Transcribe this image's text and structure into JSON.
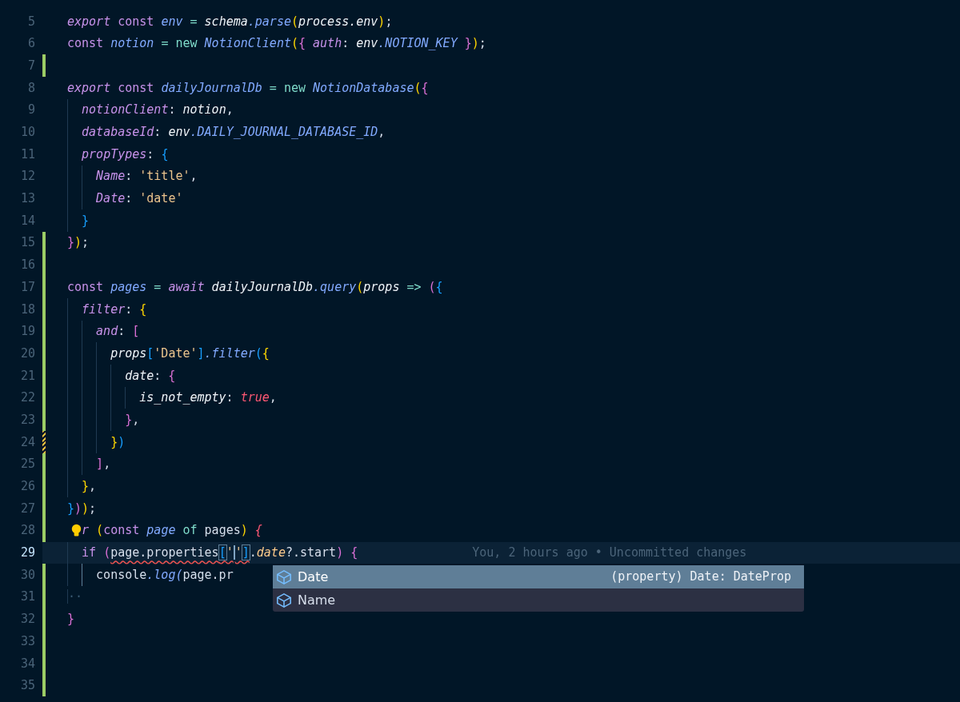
{
  "editor": {
    "lines": [
      {
        "number": "5",
        "added": false,
        "modified": false,
        "current": false,
        "tokens": [
          {
            "text": "export",
            "kind": "kwi"
          },
          {
            "text": " const",
            "kind": "kw"
          },
          {
            "text": " env",
            "kind": "var"
          },
          {
            "text": " =",
            "kind": "op"
          },
          {
            "text": " schema",
            "kind": "plaini"
          },
          {
            "text": ".parse",
            "kind": "fn"
          },
          {
            "text": "(",
            "kind": "b1"
          },
          {
            "text": "process.env",
            "kind": "plaini"
          },
          {
            "text": ")",
            "kind": "b1"
          },
          {
            "text": ";"
          }
        ]
      },
      {
        "number": "6",
        "added": false,
        "modified": false,
        "current": false,
        "tokens": [
          {
            "text": "const",
            "kind": "kw"
          },
          {
            "text": " notion",
            "kind": "var"
          },
          {
            "text": " =",
            "kind": "op"
          },
          {
            "text": " new",
            "kind": "op"
          },
          {
            "text": " NotionClient",
            "kind": "fn"
          },
          {
            "text": "(",
            "kind": "b1"
          },
          {
            "text": "{",
            "kind": "b2"
          },
          {
            "text": " auth",
            "kind": "prop"
          },
          {
            "text": ":"
          },
          {
            "text": " env",
            "kind": "plaini"
          },
          {
            "text": ".NOTION_KEY",
            "kind": "fn"
          },
          {
            "text": " }",
            "kind": "b2"
          },
          {
            "text": ")",
            "kind": "b1"
          },
          {
            "text": ";"
          }
        ]
      },
      {
        "number": "7",
        "added": true,
        "modified": false,
        "current": false
      },
      {
        "number": "8",
        "added": false,
        "modified": false,
        "current": false,
        "tokens": [
          {
            "text": "export",
            "kind": "kwi"
          },
          {
            "text": " const",
            "kind": "kw"
          },
          {
            "text": " dailyJournalDb",
            "kind": "var"
          },
          {
            "text": " =",
            "kind": "op"
          },
          {
            "text": " new",
            "kind": "op"
          },
          {
            "text": " NotionDatabase",
            "kind": "fn"
          },
          {
            "text": "(",
            "kind": "b1"
          },
          {
            "text": "{",
            "kind": "b2"
          }
        ]
      },
      {
        "number": "9",
        "added": false,
        "modified": false,
        "current": false,
        "guides": [
          {
            "active": false
          }
        ],
        "tokens": [
          {
            "text": "notionClient",
            "kind": "prop"
          },
          {
            "text": ":"
          },
          {
            "text": " notion",
            "kind": "plaini"
          },
          {
            "text": ","
          }
        ]
      },
      {
        "number": "10",
        "added": false,
        "modified": false,
        "current": false,
        "guides": [
          {
            "active": false
          }
        ],
        "tokens": [
          {
            "text": "databaseId",
            "kind": "prop"
          },
          {
            "text": ":"
          },
          {
            "text": " env",
            "kind": "plaini"
          },
          {
            "text": ".DAILY_JOURNAL_DATABASE_ID",
            "kind": "fn"
          },
          {
            "text": ","
          }
        ]
      },
      {
        "number": "11",
        "added": false,
        "modified": false,
        "current": false,
        "guides": [
          {
            "active": false
          }
        ],
        "tokens": [
          {
            "text": "propTypes",
            "kind": "prop"
          },
          {
            "text": ":"
          },
          {
            "text": " {",
            "kind": "b3"
          }
        ]
      },
      {
        "number": "12",
        "added": false,
        "modified": false,
        "current": false,
        "guides": [
          {
            "active": false
          },
          {
            "active": false
          }
        ],
        "tokens": [
          {
            "text": "Name",
            "kind": "prop"
          },
          {
            "text": ":"
          },
          {
            "text": " 'title'",
            "kind": "str"
          },
          {
            "text": ","
          }
        ]
      },
      {
        "number": "13",
        "added": false,
        "modified": false,
        "current": false,
        "guides": [
          {
            "active": false
          },
          {
            "active": false
          }
        ],
        "tokens": [
          {
            "text": "Date",
            "kind": "prop"
          },
          {
            "text": ":"
          },
          {
            "text": " 'date'",
            "kind": "str"
          }
        ]
      },
      {
        "number": "14",
        "added": false,
        "modified": false,
        "current": false,
        "guides": [
          {
            "active": false
          }
        ],
        "tokens": [
          {
            "text": "}",
            "kind": "b3"
          }
        ]
      },
      {
        "number": "15",
        "added": true,
        "modified": false,
        "current": false,
        "tokens": [
          {
            "text": "}",
            "kind": "b2"
          },
          {
            "text": ")",
            "kind": "b1"
          },
          {
            "text": ";"
          }
        ]
      },
      {
        "number": "16",
        "added": true,
        "modified": false,
        "current": false
      },
      {
        "number": "17",
        "added": true,
        "modified": false,
        "current": false,
        "tokens": [
          {
            "text": "const",
            "kind": "kw"
          },
          {
            "text": " pages",
            "kind": "var"
          },
          {
            "text": " =",
            "kind": "op"
          },
          {
            "text": " await",
            "kind": "kwi"
          },
          {
            "text": " dailyJournalDb",
            "kind": "plaini"
          },
          {
            "text": ".query",
            "kind": "fn"
          },
          {
            "text": "(",
            "kind": "b1"
          },
          {
            "text": "props",
            "kind": "plaini"
          },
          {
            "text": " =>",
            "kind": "op"
          },
          {
            "text": " (",
            "kind": "b2"
          },
          {
            "text": "{",
            "kind": "b3"
          }
        ]
      },
      {
        "number": "18",
        "added": true,
        "modified": false,
        "current": false,
        "guides": [
          {
            "active": false
          }
        ],
        "tokens": [
          {
            "text": "filter",
            "kind": "prop"
          },
          {
            "text": ":"
          },
          {
            "text": " {",
            "kind": "b1"
          }
        ]
      },
      {
        "number": "19",
        "added": true,
        "modified": false,
        "current": false,
        "guides": [
          {
            "active": false
          },
          {
            "active": false
          }
        ],
        "tokens": [
          {
            "text": "and",
            "kind": "prop"
          },
          {
            "text": ":"
          },
          {
            "text": " [",
            "kind": "b2"
          }
        ]
      },
      {
        "number": "20",
        "added": true,
        "modified": false,
        "current": false,
        "guides": [
          {
            "active": false
          },
          {
            "active": false
          },
          {
            "active": false
          }
        ],
        "tokens": [
          {
            "text": "props",
            "kind": "plaini"
          },
          {
            "text": "[",
            "kind": "b3"
          },
          {
            "text": "'Date'",
            "kind": "str"
          },
          {
            "text": "]",
            "kind": "b3"
          },
          {
            "text": ".filter",
            "kind": "fn"
          },
          {
            "text": "(",
            "kind": "b3"
          },
          {
            "text": "{",
            "kind": "b1"
          }
        ]
      },
      {
        "number": "21",
        "added": true,
        "modified": false,
        "current": false,
        "guides": [
          {
            "active": false
          },
          {
            "active": false
          },
          {
            "active": false
          },
          {
            "active": false
          }
        ],
        "tokens": [
          {
            "text": "date",
            "kind": "plaini"
          },
          {
            "text": ":"
          },
          {
            "text": " {",
            "kind": "b2"
          }
        ]
      },
      {
        "number": "22",
        "added": true,
        "modified": false,
        "current": false,
        "guides": [
          {
            "active": false
          },
          {
            "active": false
          },
          {
            "active": false
          },
          {
            "active": false
          },
          {
            "active": false
          }
        ],
        "tokens": [
          {
            "text": "is_not_empty",
            "kind": "plaini"
          },
          {
            "text": ":"
          },
          {
            "text": " true",
            "kind": "bool"
          },
          {
            "text": ","
          }
        ]
      },
      {
        "number": "23",
        "added": true,
        "modified": false,
        "current": false,
        "guides": [
          {
            "active": false
          },
          {
            "active": false
          },
          {
            "active": false
          },
          {
            "active": false
          }
        ],
        "tokens": [
          {
            "text": "}",
            "kind": "b2"
          },
          {
            "text": ","
          }
        ]
      },
      {
        "number": "24",
        "added": false,
        "modified": true,
        "current": false,
        "guides": [
          {
            "active": false
          },
          {
            "active": false
          },
          {
            "active": false
          }
        ],
        "tokens": [
          {
            "text": "}",
            "kind": "b1"
          },
          {
            "text": ")",
            "kind": "b3"
          }
        ]
      },
      {
        "number": "25",
        "added": true,
        "modified": false,
        "current": false,
        "guides": [
          {
            "active": false
          },
          {
            "active": false
          }
        ],
        "tokens": [
          {
            "text": "]",
            "kind": "b2"
          },
          {
            "text": ","
          }
        ]
      },
      {
        "number": "26",
        "added": true,
        "modified": false,
        "current": false,
        "guides": [
          {
            "active": false
          }
        ],
        "tokens": [
          {
            "text": "}",
            "kind": "b1"
          },
          {
            "text": ","
          }
        ]
      },
      {
        "number": "27",
        "added": true,
        "modified": false,
        "current": false,
        "tokens": [
          {
            "text": "}",
            "kind": "b3"
          },
          {
            "text": ")",
            "kind": "b2"
          },
          {
            "text": ")",
            "kind": "b1"
          },
          {
            "text": ";"
          }
        ]
      },
      {
        "number": "28",
        "added": true,
        "modified": false,
        "current": false,
        "lightbulb": true,
        "tokens": [
          {
            "text": "r",
            "kind": "kwi"
          },
          {
            "text": " (",
            "kind": "b1"
          },
          {
            "text": "const",
            "kind": "kw"
          },
          {
            "text": " page",
            "kind": "var"
          },
          {
            "text": " of",
            "kind": "op"
          },
          {
            "text": " pages"
          },
          {
            "text": ")",
            "kind": "b1"
          },
          {
            "text": " {",
            "kind": "bool"
          }
        ]
      },
      {
        "number": "29",
        "added": true,
        "modified": false,
        "current": true,
        "blame": "You, 2 hours ago • Uncommitted changes",
        "guides": [
          {
            "active": false
          }
        ],
        "tokens": [
          {
            "text": "if",
            "kind": "kw"
          },
          {
            "text": " (",
            "kind": "b2"
          },
          {
            "text": "page.properties",
            "error": true
          },
          {
            "text": "[",
            "kind": "match",
            "error": true
          },
          {
            "text": "'",
            "kind": "str",
            "error": true
          },
          {
            "text": "'",
            "kind": "str",
            "error": true,
            "cursor": true
          },
          {
            "text": "]",
            "kind": "match",
            "error": true
          },
          {
            "text": "."
          },
          {
            "text": "date",
            "kind": "propy"
          },
          {
            "text": "?.start"
          },
          {
            "text": ")",
            "kind": "b2"
          },
          {
            "text": " {",
            "kind": "b2"
          }
        ]
      },
      {
        "number": "30",
        "added": true,
        "modified": false,
        "current": false,
        "guides": [
          {
            "active": false
          },
          {
            "active": true
          }
        ],
        "tokens": [
          {
            "text": "console"
          },
          {
            "text": ".log",
            "kind": "fn"
          },
          {
            "text": "(",
            "kind": "fn"
          },
          {
            "text": "page.pr"
          }
        ]
      },
      {
        "number": "31",
        "added": true,
        "modified": false,
        "current": false,
        "tokens": [
          {
            "text": "··",
            "kind": "ws"
          }
        ]
      },
      {
        "number": "32",
        "added": true,
        "modified": false,
        "current": false,
        "tokens": [
          {
            "text": "}",
            "kind": "b2"
          }
        ]
      },
      {
        "number": "33",
        "added": true,
        "modified": false,
        "current": false
      },
      {
        "number": "34",
        "added": true,
        "modified": false,
        "current": false
      },
      {
        "number": "35",
        "added": true,
        "modified": false,
        "current": false
      }
    ]
  },
  "autocomplete": {
    "items": [
      {
        "label": "Date",
        "detail": "(property) Date: DateProp",
        "selected": true
      },
      {
        "label": "Name",
        "selected": false
      }
    ]
  }
}
